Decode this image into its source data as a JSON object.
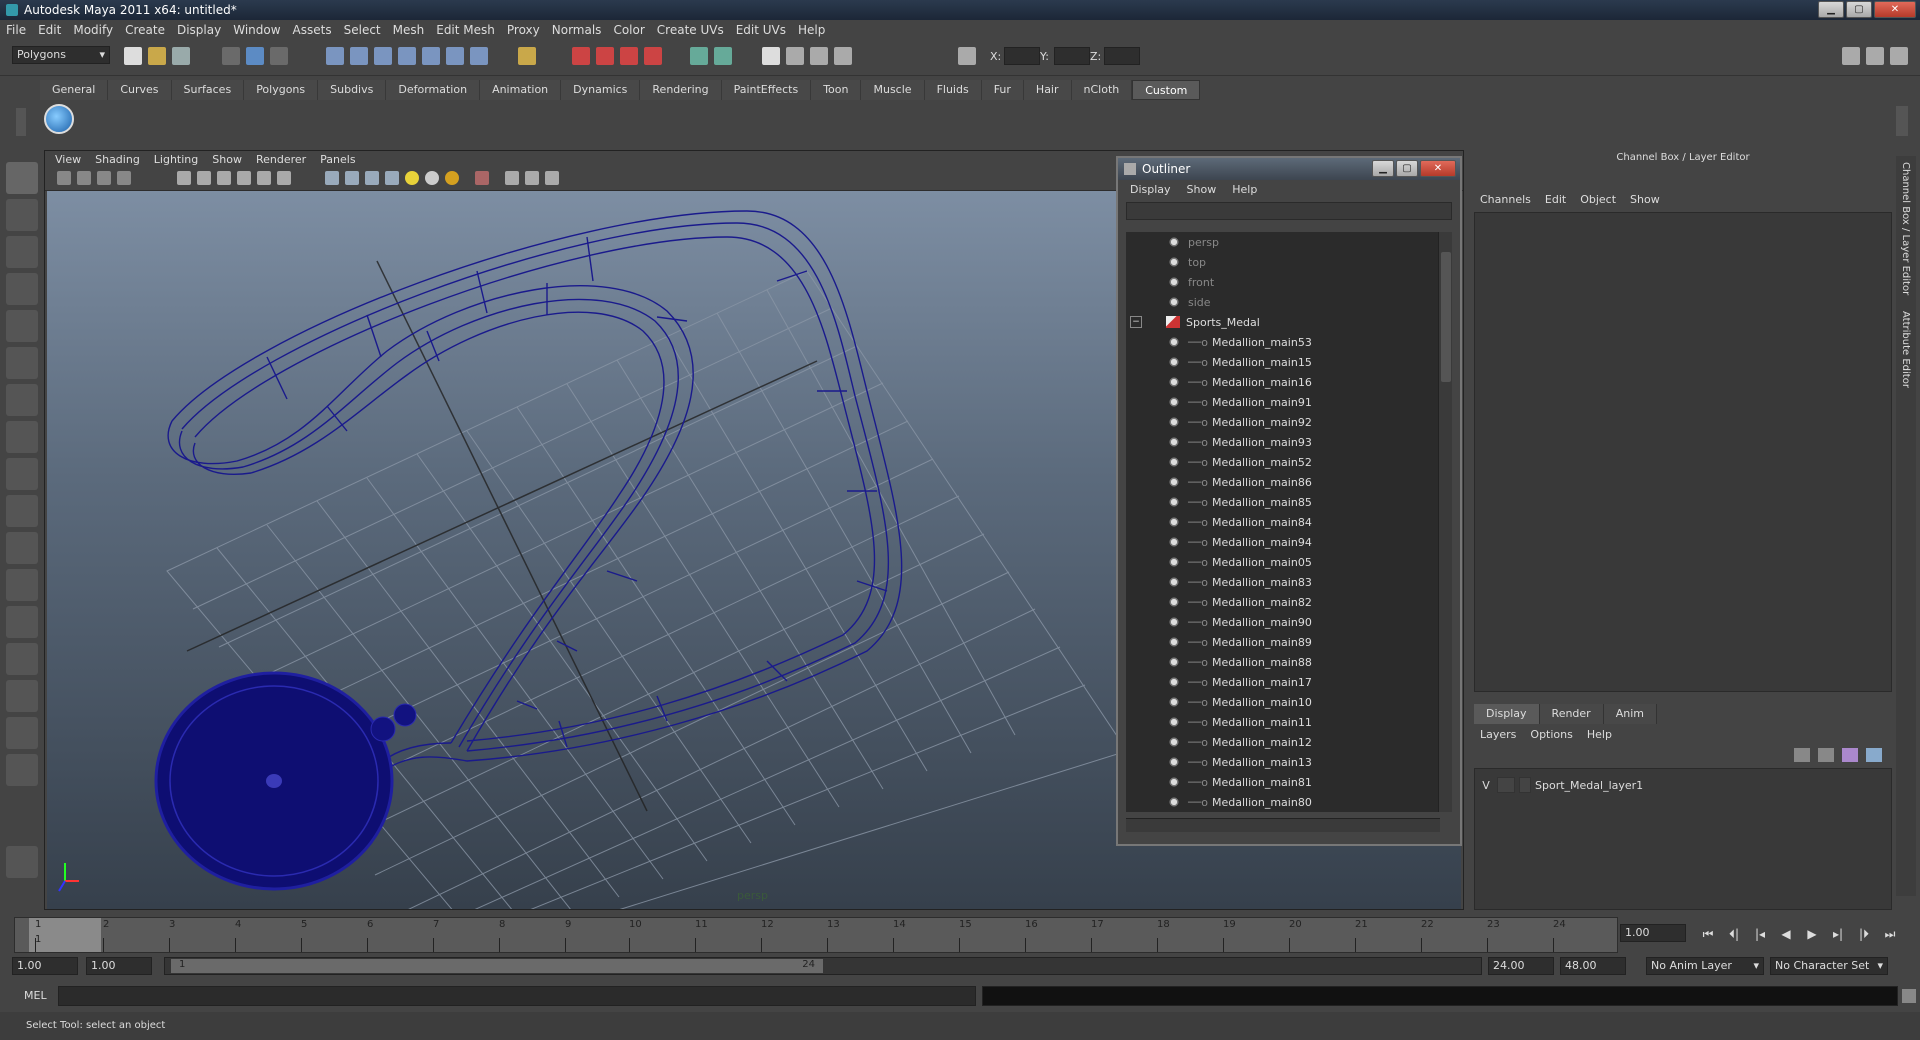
{
  "window": {
    "title": "Autodesk Maya 2011 x64: untitled*"
  },
  "menubar": [
    "File",
    "Edit",
    "Modify",
    "Create",
    "Display",
    "Window",
    "Assets",
    "Select",
    "Mesh",
    "Edit Mesh",
    "Proxy",
    "Normals",
    "Color",
    "Create UVs",
    "Edit UVs",
    "Help"
  ],
  "statusline": {
    "mode": "Polygons",
    "x_label": "X:",
    "y_label": "Y:",
    "z_label": "Z:"
  },
  "shelf_tabs": [
    "General",
    "Curves",
    "Surfaces",
    "Polygons",
    "Subdivs",
    "Deformation",
    "Animation",
    "Dynamics",
    "Rendering",
    "PaintEffects",
    "Toon",
    "Muscle",
    "Fluids",
    "Fur",
    "Hair",
    "nCloth",
    "Custom"
  ],
  "active_shelf": "Custom",
  "viewport": {
    "menus": [
      "View",
      "Shading",
      "Lighting",
      "Show",
      "Renderer",
      "Panels"
    ],
    "camera_label": "persp"
  },
  "outliner": {
    "title": "Outliner",
    "menus": [
      "Display",
      "Show",
      "Help"
    ],
    "cameras": [
      "persp",
      "top",
      "front",
      "side"
    ],
    "group": "Sports_Medal",
    "children": [
      "Medallion_main53",
      "Medallion_main15",
      "Medallion_main16",
      "Medallion_main91",
      "Medallion_main92",
      "Medallion_main93",
      "Medallion_main52",
      "Medallion_main86",
      "Medallion_main85",
      "Medallion_main84",
      "Medallion_main94",
      "Medallion_main05",
      "Medallion_main83",
      "Medallion_main82",
      "Medallion_main90",
      "Medallion_main89",
      "Medallion_main88",
      "Medallion_main17",
      "Medallion_main10",
      "Medallion_main11",
      "Medallion_main12",
      "Medallion_main13",
      "Medallion_main81",
      "Medallion_main80"
    ]
  },
  "channelbox": {
    "title": "Channel Box / Layer Editor",
    "menus": [
      "Channels",
      "Edit",
      "Object",
      "Show"
    ],
    "layer_tabs": [
      "Display",
      "Render",
      "Anim"
    ],
    "layer_menus": [
      "Layers",
      "Options",
      "Help"
    ],
    "layer": {
      "visible": "V",
      "name": "Sport_Medal_layer1"
    },
    "side_tabs": [
      "Channel Box / Layer Editor",
      "Attribute Editor"
    ]
  },
  "timeline": {
    "ticks": [
      "1",
      "2",
      "3",
      "4",
      "5",
      "6",
      "7",
      "8",
      "9",
      "10",
      "11",
      "12",
      "13",
      "14",
      "15",
      "16",
      "17",
      "18",
      "19",
      "20",
      "21",
      "22",
      "23",
      "24"
    ],
    "current_frame_label": "1",
    "current_time": "1.00"
  },
  "range": {
    "start": "1.00",
    "inner_start": "1.00",
    "slider_start": "1",
    "slider_end": "24",
    "end": "24.00",
    "outer_end": "48.00",
    "anim_layer": "No Anim Layer",
    "char_set": "No Character Set"
  },
  "cmdline": {
    "label": "MEL"
  },
  "helpline": {
    "text": "Select Tool: select an object"
  },
  "colors": {
    "wire": "#1a1a8c",
    "accent": "#5a5a5a"
  }
}
